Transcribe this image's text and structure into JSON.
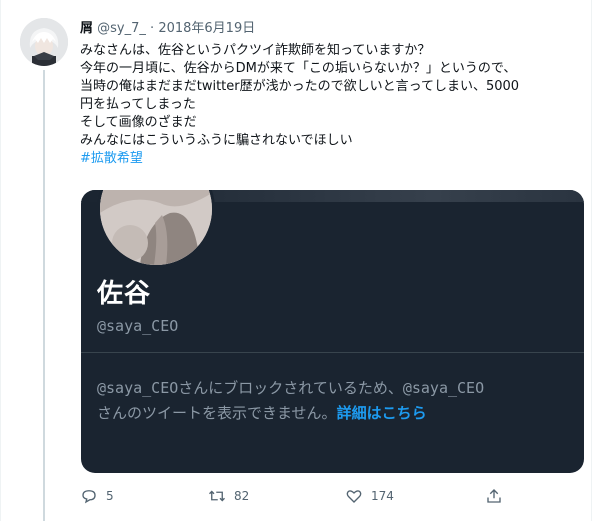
{
  "tweet": {
    "display_name": "屑",
    "handle": "@sy_7_",
    "separator": "·",
    "date": "2018年6月19日",
    "lines": [
      "みなさんは、佐谷というパクツイ詐欺師を知っていますか？",
      "今年の一月頃に、佐谷からDMが来て「この垢いらないか？」というので、",
      "当時の俺はまだまだtwitter歴が浅かったので欲しいと言ってしまい、5000",
      "円を払ってしまった",
      "そして画像のざまだ",
      "みんなにはこういうふうに騙されないでほしい"
    ],
    "hashtag": "#拡散希望"
  },
  "embedded_profile": {
    "name": "佐谷",
    "handle": "@saya_CEO",
    "blocked_line1": "@saya_CEOさんにブロックされているため、@saya_CEO",
    "blocked_line2": "さんのツイートを表示できません。",
    "blocked_link": "詳細はこちら"
  },
  "actions": {
    "reply_count": "5",
    "retweet_count": "82",
    "like_count": "174"
  },
  "icons": [
    "reply-icon",
    "retweet-icon",
    "like-icon",
    "share-icon"
  ],
  "colors": {
    "accent": "#1d9bf0",
    "card_bg": "#1a2430",
    "muted": "#536471"
  }
}
